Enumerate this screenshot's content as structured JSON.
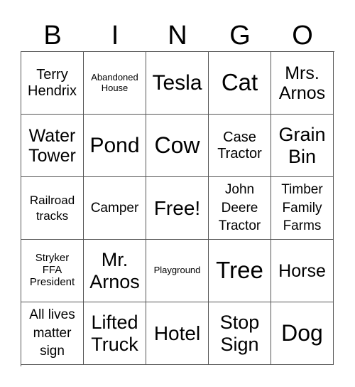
{
  "header": {
    "letters": [
      "B",
      "I",
      "N",
      "G",
      "O"
    ]
  },
  "grid": {
    "rows": [
      [
        "Terry\nHendrix",
        "Abandoned\nHouse",
        "Tesla",
        "Cat",
        "Mrs.\nArnos"
      ],
      [
        "Water\nTower",
        "Pond",
        "Cow",
        "Case\nTractor",
        "Grain\nBin"
      ],
      [
        "Railroad\ntracks",
        "Camper",
        "Free!",
        "John\nDeere\nTractor",
        "Timber\nFamily\nFarms"
      ],
      [
        "Stryker\nFFA\nPresident",
        "Mr.\nArnos",
        "Playground",
        "Tree",
        "Horse"
      ],
      [
        "All lives\nmatter\nsign",
        "Lifted\nTruck",
        "Hotel",
        "Stop\nSign",
        "Dog"
      ]
    ]
  }
}
